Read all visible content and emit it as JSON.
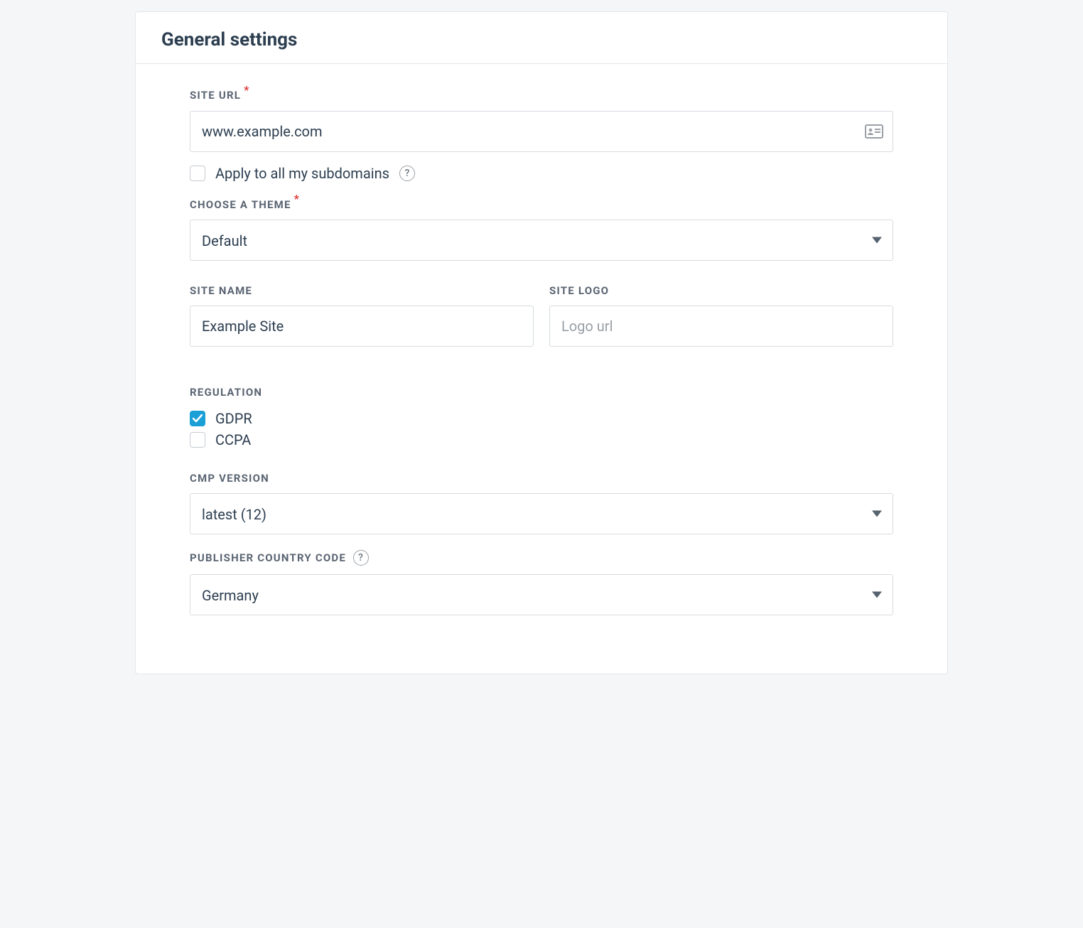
{
  "header": {
    "title": "General settings"
  },
  "labels": {
    "site_url": "Site URL",
    "apply_subdomains": "Apply to all my subdomains",
    "choose_theme": "Choose a theme",
    "site_name": "Site Name",
    "site_logo": "Site Logo",
    "regulation": "Regulation",
    "gdpr": "GDPR",
    "ccpa": "CCPA",
    "cmp_version": "CMP Version",
    "publisher_country_code": "Publisher Country Code"
  },
  "required_marker": "*",
  "help_glyph": "?",
  "values": {
    "site_url": "www.example.com",
    "theme": "Default",
    "site_name": "Example Site",
    "site_logo": "",
    "cmp_version": "latest (12)",
    "publisher_country_code": "Germany",
    "apply_subdomains_checked": false,
    "gdpr_checked": true,
    "ccpa_checked": false
  },
  "placeholders": {
    "site_logo": "Logo url"
  }
}
